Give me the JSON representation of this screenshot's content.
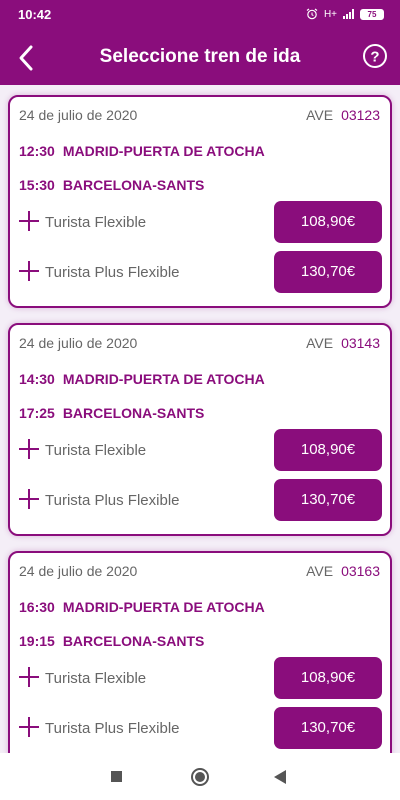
{
  "status_bar": {
    "time": "10:42",
    "battery": "75",
    "network": "H+"
  },
  "header": {
    "title": "Seleccione tren de ida"
  },
  "icons": {
    "back": "back-arrow-icon",
    "help": "help-circle-icon",
    "fare": "plus-icon"
  },
  "colors": {
    "primary": "#8a0d7c",
    "background": "#f4eef7"
  },
  "trains": [
    {
      "date": "24 de julio de 2020",
      "type": "AVE",
      "number": "03123",
      "departure": {
        "time": "12:30",
        "station": "MADRID-PUERTA DE ATOCHA"
      },
      "arrival": {
        "time": "15:30",
        "station": "BARCELONA-SANTS"
      },
      "fares": [
        {
          "name": "Turista Flexible",
          "price": "108,90€"
        },
        {
          "name": "Turista Plus Flexible",
          "price": "130,70€"
        }
      ]
    },
    {
      "date": "24 de julio de 2020",
      "type": "AVE",
      "number": "03143",
      "departure": {
        "time": "14:30",
        "station": "MADRID-PUERTA DE ATOCHA"
      },
      "arrival": {
        "time": "17:25",
        "station": "BARCELONA-SANTS"
      },
      "fares": [
        {
          "name": "Turista Flexible",
          "price": "108,90€"
        },
        {
          "name": "Turista Plus Flexible",
          "price": "130,70€"
        }
      ]
    },
    {
      "date": "24 de julio de 2020",
      "type": "AVE",
      "number": "03163",
      "departure": {
        "time": "16:30",
        "station": "MADRID-PUERTA DE ATOCHA"
      },
      "arrival": {
        "time": "19:15",
        "station": "BARCELONA-SANTS"
      },
      "fares": [
        {
          "name": "Turista Flexible",
          "price": "108,90€"
        },
        {
          "name": "Turista Plus Flexible",
          "price": "130,70€"
        }
      ]
    }
  ]
}
